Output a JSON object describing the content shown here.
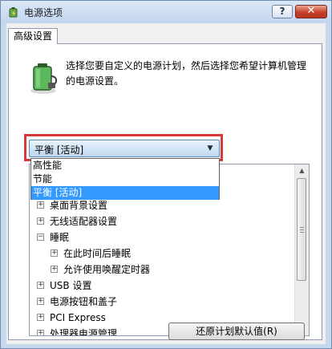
{
  "window": {
    "title": "电源选项",
    "help_label": "?",
    "close_label": "✕"
  },
  "tabs": [
    {
      "label": "高级设置"
    }
  ],
  "intro": {
    "line1": "选择您要自定义的电源计划，然后选择您希望计算机管理",
    "line2": "的电源设置。"
  },
  "plan_select": {
    "value": "平衡 [活动]",
    "options": [
      "高性能",
      "节能",
      "平衡 [活动]"
    ],
    "selected_index": 2
  },
  "tree": {
    "items": [
      {
        "label": "桌面背景设置",
        "expander": "+",
        "level": 0
      },
      {
        "label": "无线适配器设置",
        "expander": "+",
        "level": 0
      },
      {
        "label": "睡眠",
        "expander": "−",
        "level": 0
      },
      {
        "label": "在此时间后睡眠",
        "expander": "+",
        "level": 1
      },
      {
        "label": "允许使用唤醒定时器",
        "expander": "+",
        "level": 1
      },
      {
        "label": "USB 设置",
        "expander": "+",
        "level": 0
      },
      {
        "label": "电源按钮和盖子",
        "expander": "+",
        "level": 0
      },
      {
        "label": "PCI Express",
        "expander": "+",
        "level": 0
      },
      {
        "label": "处理器电源管理",
        "expander": "+",
        "level": 0
      }
    ]
  },
  "restore_button": {
    "label": "还原计划默认值(R)"
  },
  "colors": {
    "highlight_border": "#d43a3a",
    "selection": "#3399ff"
  }
}
